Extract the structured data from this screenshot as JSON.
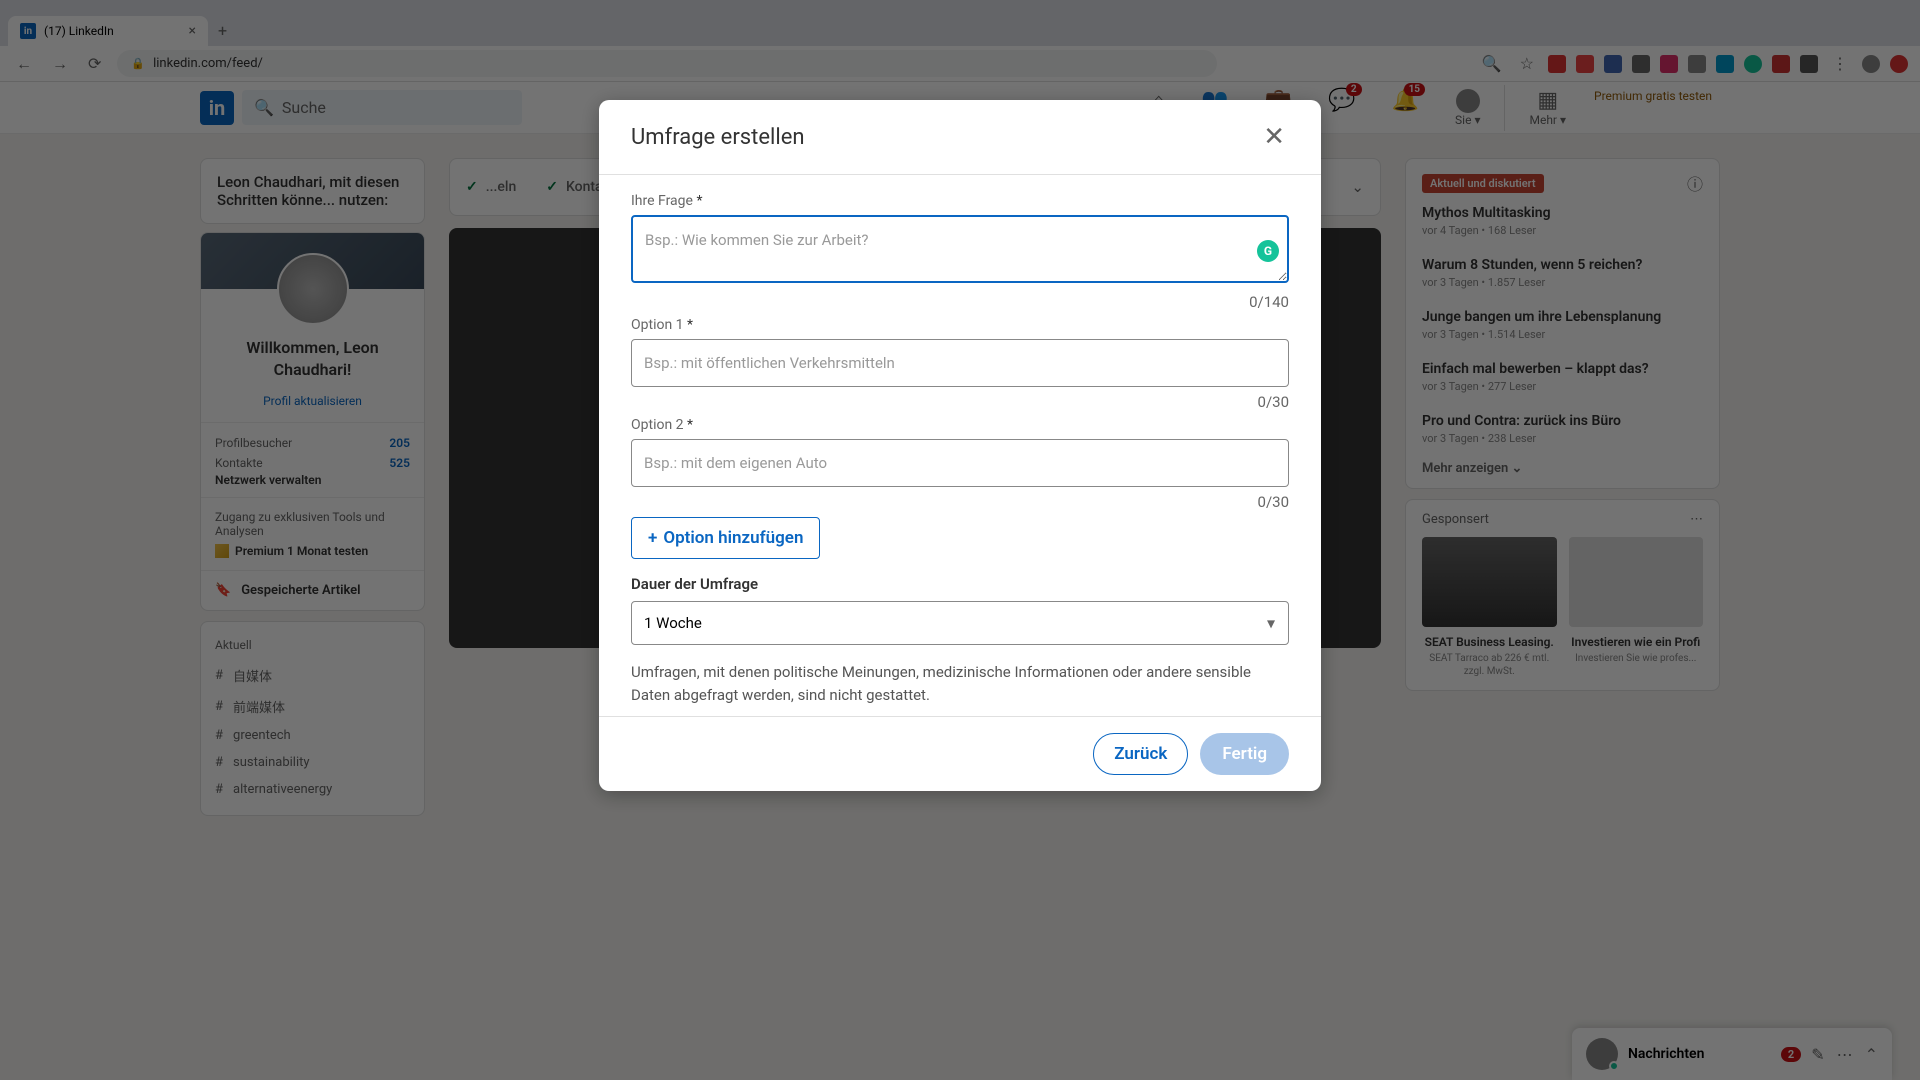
{
  "browser": {
    "tab_title": "(17) LinkedIn",
    "url": "linkedin.com/feed/"
  },
  "header": {
    "search_placeholder": "Suche",
    "nav": {
      "home": "",
      "network": "",
      "jobs": "",
      "messaging": "",
      "messaging_badge": "2",
      "notifications": "",
      "notifications_badge": "15",
      "me": "Sie",
      "work": "Mehr"
    },
    "premium": "Premium gratis testen"
  },
  "prompt_bar": "Leon Chaudhari, mit diesen Schritten könne... nutzen:",
  "checks": {
    "a": "...eln",
    "b": "Kontakte hinzugefügt"
  },
  "profile": {
    "welcome": "Willkommen, Leon Chaudhari!",
    "update_link": "Profil aktualisieren",
    "visitors_label": "Profilbesucher",
    "visitors_val": "205",
    "contacts_label": "Kontakte",
    "contacts_val": "525",
    "manage_network": "Netzwerk verwalten",
    "premium_text": "Zugang zu exklusiven Tools und Analysen",
    "premium_cta": "Premium 1 Monat testen",
    "saved": "Gespeicherte Artikel"
  },
  "recent": {
    "title": "Aktuell",
    "items": [
      "自媒体",
      "前端媒体",
      "greentech",
      "sustainability",
      "alternativeenergy"
    ]
  },
  "news": {
    "badge": "Aktuell und diskutiert",
    "items": [
      {
        "title": "Mythos Multitasking",
        "meta": "vor 4 Tagen • 168 Leser"
      },
      {
        "title": "Warum 8 Stunden, wenn 5 reichen?",
        "meta": "vor 3 Tagen • 1.857 Leser"
      },
      {
        "title": "Junge bangen um ihre Lebensplanung",
        "meta": "vor 3 Tagen • 1.514 Leser"
      },
      {
        "title": "Einfach mal bewerben – klappt das?",
        "meta": "vor 3 Tagen • 277 Leser"
      },
      {
        "title": "Pro und Contra: zurück ins Büro",
        "meta": "vor 3 Tagen • 238 Leser"
      }
    ],
    "show_more": "Mehr anzeigen"
  },
  "sponsored": {
    "label": "Gesponsert",
    "ads": [
      {
        "title": "SEAT Business Leasing.",
        "sub": "SEAT Tarraco ab 226 € mtl. zzgl. MwSt."
      },
      {
        "title": "Investieren wie ein Profi",
        "sub": "Investieren Sie wie profes..."
      }
    ]
  },
  "modal": {
    "title": "Umfrage erstellen",
    "question_label": "Ihre Frage",
    "question_placeholder": "Bsp.: Wie kommen Sie zur Arbeit?",
    "question_counter": "0/140",
    "option1_label": "Option 1",
    "option1_placeholder": "Bsp.: mit öffentlichen Verkehrsmitteln",
    "option1_counter": "0/30",
    "option2_label": "Option 2",
    "option2_placeholder": "Bsp.: mit dem eigenen Auto",
    "option2_counter": "0/30",
    "add_option": "Option hinzufügen",
    "duration_label": "Dauer der Umfrage",
    "duration_value": "1 Woche",
    "disclaimer": "Umfragen, mit denen politische Meinungen, medizinische Informationen oder andere sensible Daten abgefragt werden, sind nicht gestattet.",
    "back": "Zurück",
    "done": "Fertig"
  },
  "messaging": {
    "title": "Nachrichten",
    "badge": "2"
  }
}
